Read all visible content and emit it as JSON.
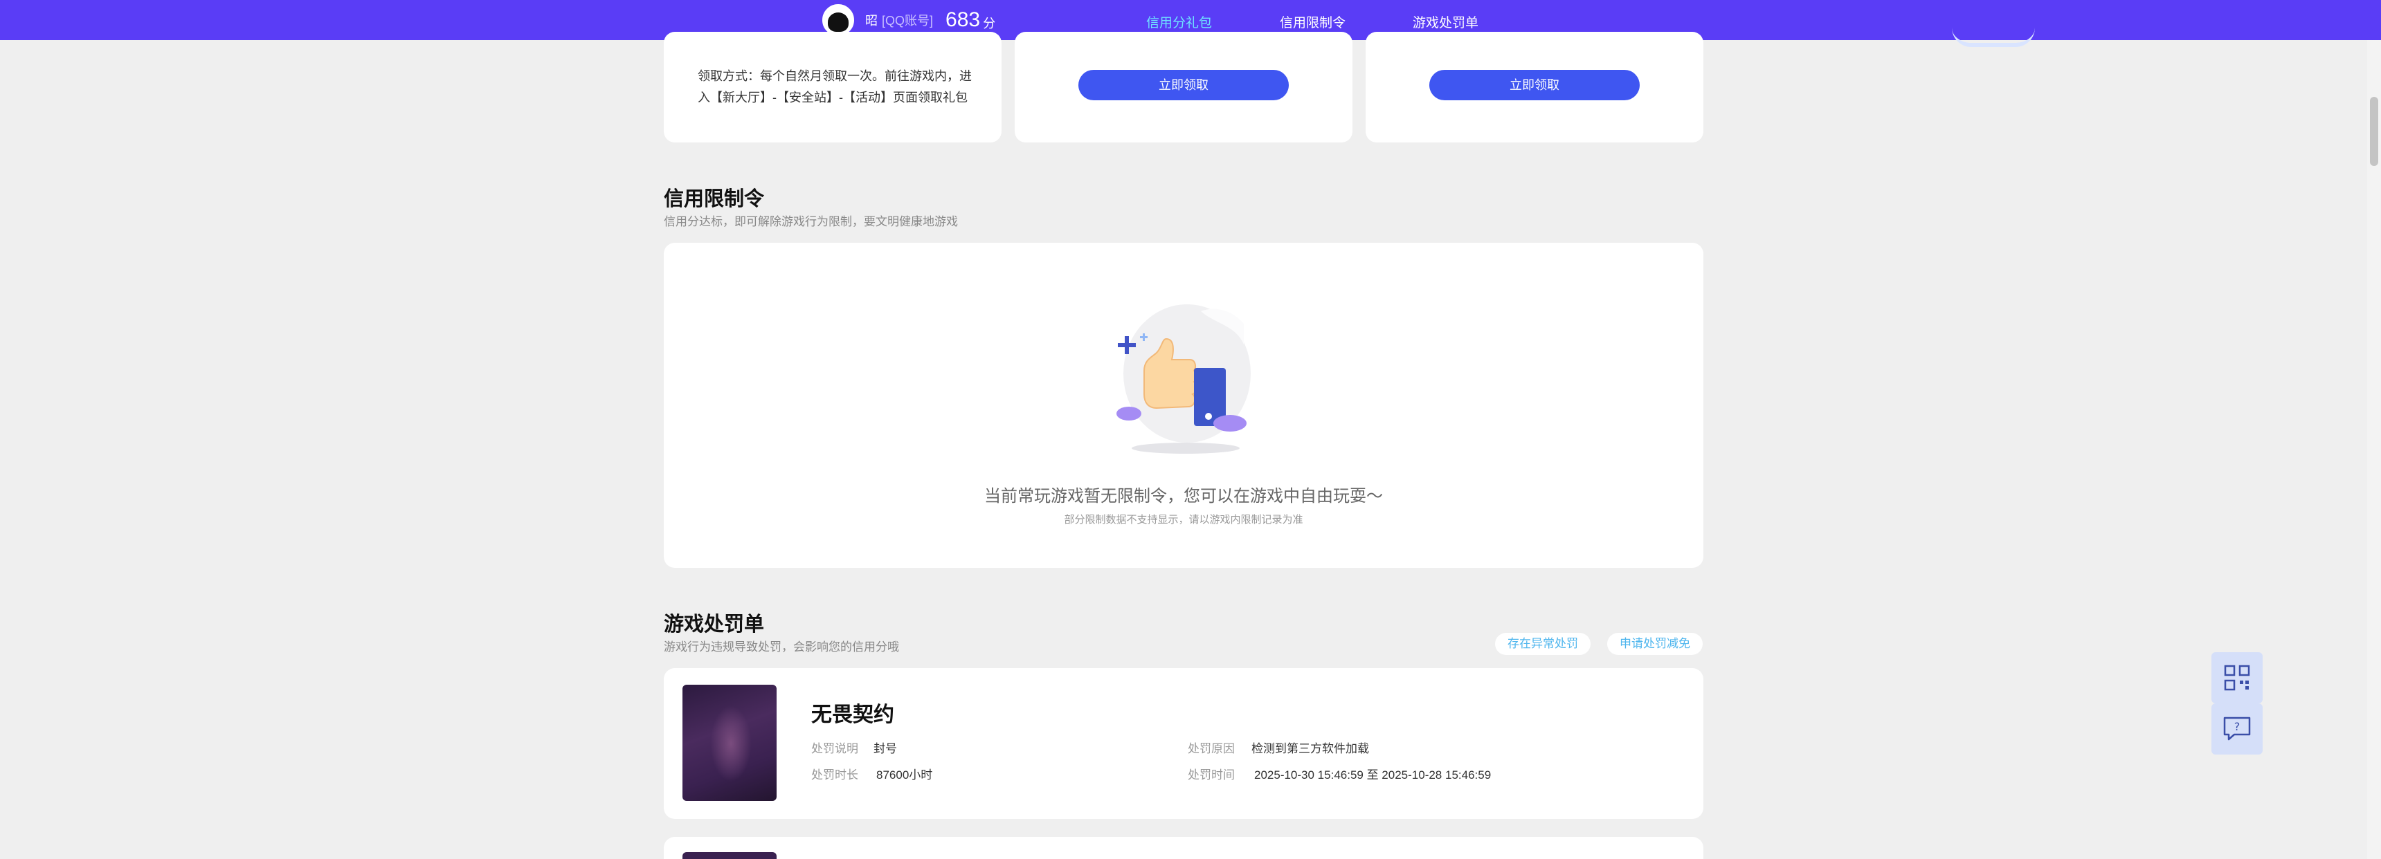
{
  "nav": {
    "user_name": "昭",
    "account_type": "[QQ账号]",
    "score": "683",
    "score_unit": "分",
    "tabs": [
      {
        "label": "信用分礼包",
        "active": true
      },
      {
        "label": "信用限制令",
        "active": false
      },
      {
        "label": "游戏处罚单",
        "active": false
      }
    ]
  },
  "gifts": {
    "claim_desc": "领取方式：每个自然月领取一次。前往游戏内，进入【新大厅】-【安全站】-【活动】页面领取礼包",
    "claim_button": "立即领取"
  },
  "restriction": {
    "title": "信用限制令",
    "subtitle": "信用分达标，即可解除游戏行为限制，要文明健康地游戏",
    "empty_main": "当前常玩游戏暂无限制令，您可以在游戏中自由玩耍～",
    "empty_sub": "部分限制数据不支持显示，请以游戏内限制记录为准"
  },
  "penalty": {
    "title": "游戏处罚单",
    "subtitle": "游戏行为违规导致处罚，会影响您的信用分哦",
    "btn_abnormal": "存在异常处罚",
    "btn_apply": "申请处罚减免",
    "items": [
      {
        "game": "无畏契约",
        "desc_label": "处罚说明",
        "desc_value": "封号",
        "reason_label": "处罚原因",
        "reason_value": "检测到第三方软件加载",
        "duration_label": "处罚时长",
        "duration_value": "87600小时",
        "time_label": "处罚时间",
        "time_value": "2025-10-30 15:46:59 至 2025-10-28 15:46:59"
      }
    ]
  },
  "colors": {
    "nav_bg": "#5a3df6",
    "active_tab": "#6ee1ff",
    "primary_button": "#3f56f1",
    "pill_text": "#4fb6ee"
  }
}
